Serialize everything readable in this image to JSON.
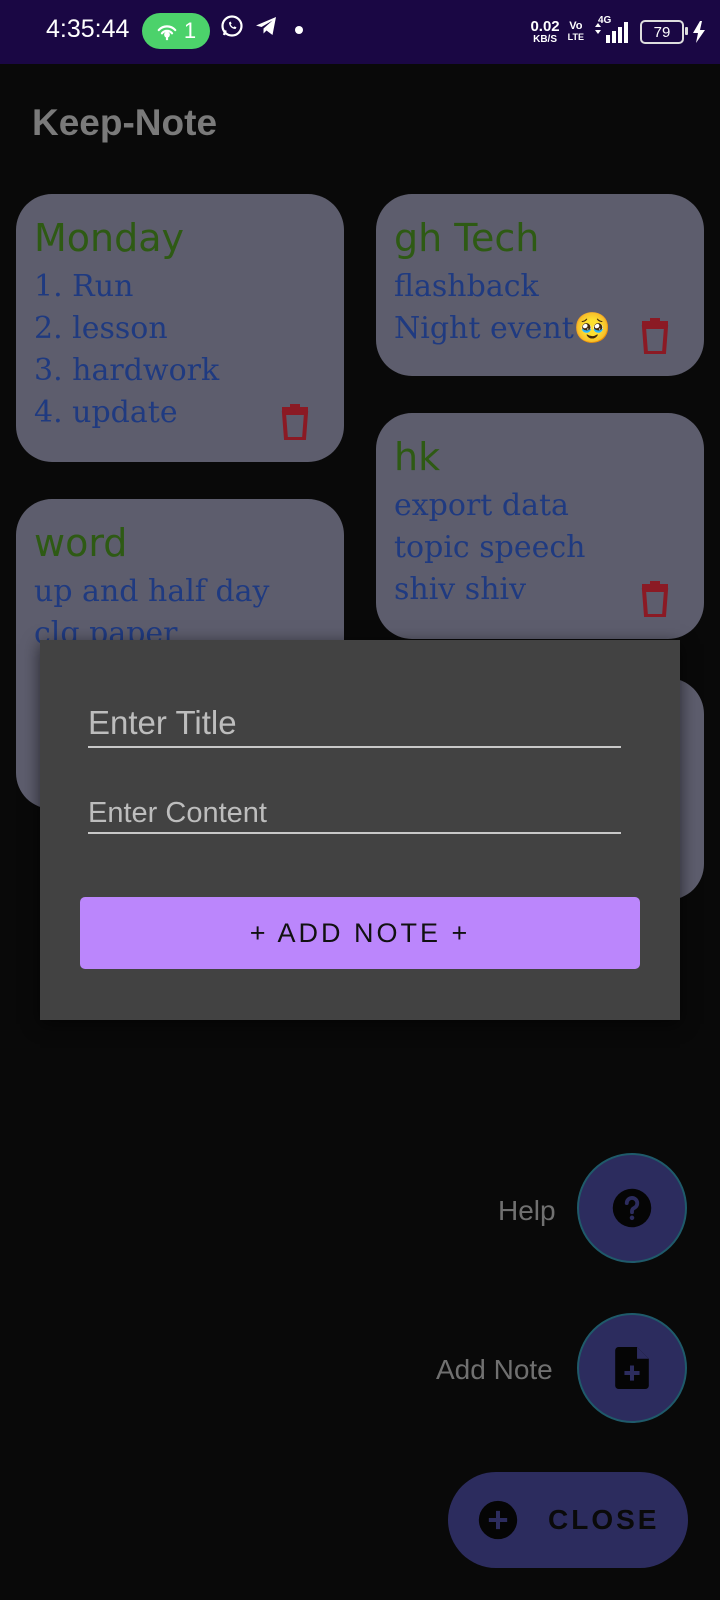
{
  "status_bar": {
    "time": "4:35:44",
    "hotspot_count": "1",
    "net_speed_value": "0.02",
    "net_speed_unit": "KB/S",
    "volte_top": "Vo",
    "volte_bottom": "LTE",
    "network": "4G",
    "battery": "79"
  },
  "app": {
    "title": "Keep-Note"
  },
  "notes": [
    {
      "title": "Monday",
      "lines": [
        "1. Run",
        "2. lesson",
        "3. hardwork",
        "4. update"
      ]
    },
    {
      "title": "gh Tech",
      "lines": [
        "flashback",
        "Night event🥹"
      ]
    },
    {
      "title": "hk",
      "lines": [
        "export data",
        "topic speech",
        "shiv shiv"
      ]
    },
    {
      "title": "word",
      "lines": [
        "up and half day",
        "clg paper"
      ]
    }
  ],
  "dialog": {
    "title_placeholder": "Enter Title",
    "content_placeholder": "Enter Content",
    "add_button": "+ ADD NOTE +"
  },
  "fab_menu": {
    "help_label": "Help",
    "add_note_label": "Add Note",
    "close_label": "CLOSE"
  },
  "icons": {
    "trash": "trash-icon",
    "help": "help-circle-icon",
    "add_note": "file-plus-icon",
    "close": "plus-circle-icon"
  },
  "colors": {
    "accent": "#bb86fc",
    "card_background": "#5d5d6d",
    "note_title": "#2e5a14",
    "note_text": "#1f3a80",
    "trash": "#8b1a24",
    "fab_background": "#2c2c5e"
  }
}
